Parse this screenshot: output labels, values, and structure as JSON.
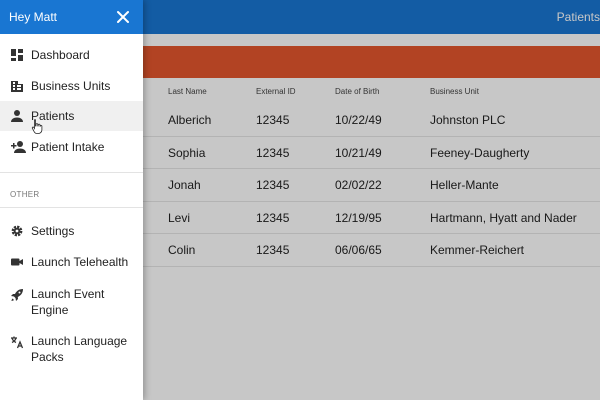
{
  "appbar": {
    "title": "Patients"
  },
  "drawer": {
    "greeting": "Hey Matt",
    "close_icon": "close-icon",
    "main_items": [
      {
        "label": "Dashboard",
        "icon": "dashboard-icon"
      },
      {
        "label": "Business Units",
        "icon": "business-icon"
      },
      {
        "label": "Patients",
        "icon": "person-icon",
        "active": true
      },
      {
        "label": "Patient Intake",
        "icon": "person-add-icon"
      }
    ],
    "section_label": "OTHER",
    "other_items": [
      {
        "label": "Settings",
        "icon": "gear-icon"
      },
      {
        "label": "Launch Telehealth",
        "icon": "videocam-icon"
      },
      {
        "label": "Launch Event Engine",
        "icon": "rocket-icon"
      },
      {
        "label": "Launch Language Packs",
        "icon": "translate-icon"
      }
    ]
  },
  "table": {
    "columns": [
      "Last Name",
      "External ID",
      "Date of Birth",
      "Business Unit"
    ],
    "rows": [
      [
        "Alberich",
        "12345",
        "10/22/49",
        "Johnston PLC"
      ],
      [
        "Sophia",
        "12345",
        "10/21/49",
        "Feeney-Daugherty"
      ],
      [
        "Jonah",
        "12345",
        "02/02/22",
        "Heller-Mante"
      ],
      [
        "Levi",
        "12345",
        "12/19/95",
        "Hartmann, Hyatt and Nader"
      ],
      [
        "Colin",
        "12345",
        "06/06/65",
        "Kemmer-Reichert"
      ]
    ]
  },
  "colors": {
    "primary": "#1976d2",
    "banner": "#e4572e"
  }
}
